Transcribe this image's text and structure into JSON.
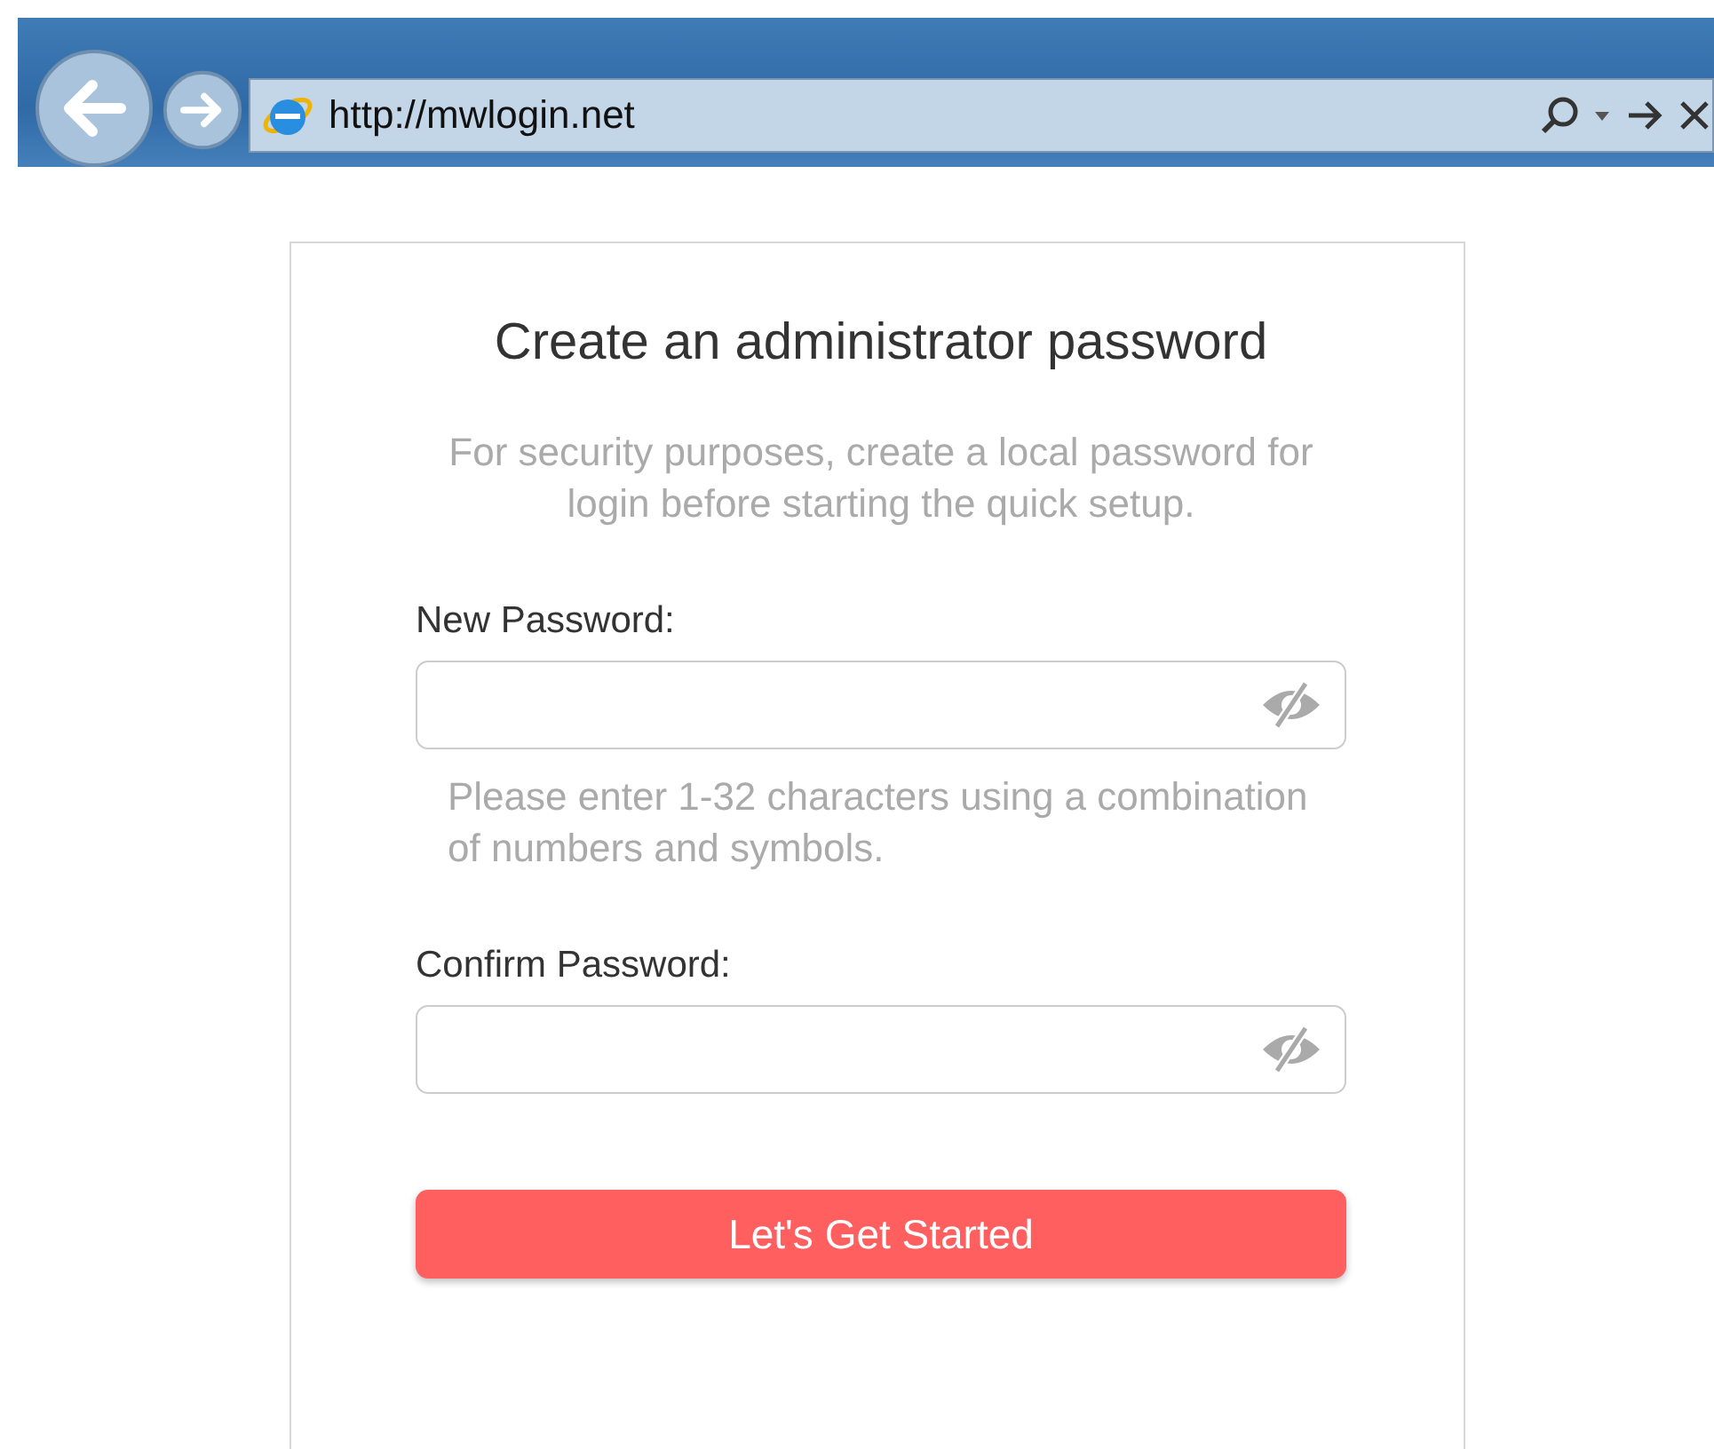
{
  "browser": {
    "url": "http://mwlogin.net"
  },
  "title": "Create an administrator password",
  "description": "For security purposes, create a local password for login before starting the quick setup.",
  "fields": [
    {
      "label": "New Password:",
      "hint": "Please enter 1-32 characters using a combination of numbers and symbols."
    },
    {
      "label": "Confirm Password:"
    }
  ],
  "button": "Let's Get Started"
}
